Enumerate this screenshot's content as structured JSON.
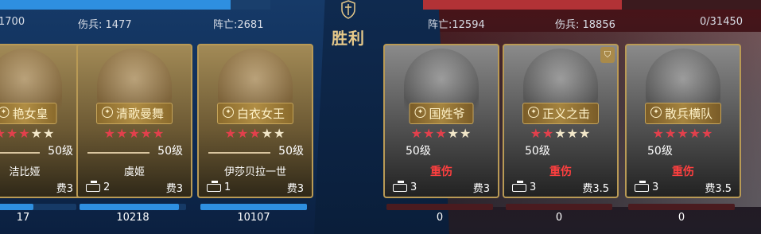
{
  "header": {
    "victory_text": "胜利",
    "left_stats": {
      "partial": "1700",
      "soldiers": "伤兵: 1477",
      "deaths": "阵亡:2681"
    },
    "right_stats": {
      "deaths": "阵亡:12594",
      "soldiers": "伤兵: 18856",
      "remaining": "0/31450"
    }
  },
  "colors": {
    "left_bar": "#2e8fe0",
    "right_bar": "#b23236",
    "star_on": "#e2404c",
    "wound": "#ff3f3f"
  },
  "left_cards": [
    {
      "name": "艳女皇",
      "stars_on": 3,
      "stars_total": 5,
      "level": "50级",
      "real_name": "洁比娅",
      "unit_count": "",
      "cost": "费3",
      "hp": "17",
      "hp_fraction": 0.6
    },
    {
      "name": "清歌曼舞",
      "stars_on": 5,
      "stars_total": 5,
      "level": "50级",
      "real_name": "虞姬",
      "unit_count": "2",
      "cost": "费3",
      "hp": "10218",
      "hp_fraction": 0.93
    },
    {
      "name": "白衣女王",
      "stars_on": 3,
      "stars_total": 5,
      "level": "50级",
      "real_name": "伊莎贝拉一世",
      "unit_count": "1",
      "cost": "费3",
      "hp": "10107",
      "hp_fraction": 1.0
    }
  ],
  "right_cards": [
    {
      "name": "国姓爷",
      "stars_on": 3,
      "stars_total": 5,
      "level": "50级",
      "status": "重伤",
      "unit_count": "3",
      "cost": "费3",
      "hp": "0",
      "hp_fraction": 0.0,
      "badge": false
    },
    {
      "name": "正义之击",
      "stars_on": 2,
      "stars_total": 5,
      "level": "50级",
      "status": "重伤",
      "unit_count": "3",
      "cost": "费3.5",
      "hp": "0",
      "hp_fraction": 0.0,
      "badge": true
    },
    {
      "name": "散兵横队",
      "stars_on": 5,
      "stars_total": 5,
      "level": "50级",
      "status": "重伤",
      "unit_count": "3",
      "cost": "费3.5",
      "hp": "0",
      "hp_fraction": 0.0,
      "badge": false
    }
  ]
}
